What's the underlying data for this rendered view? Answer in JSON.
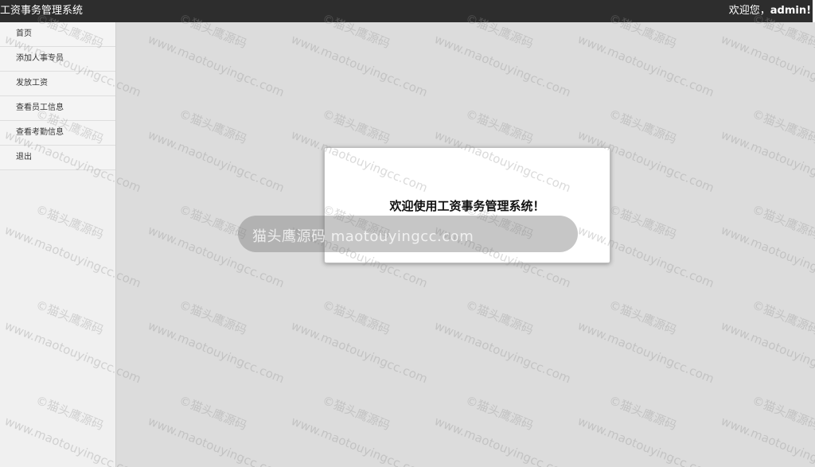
{
  "header": {
    "app_title": "工资事务管理系统",
    "greeting": "欢迎您，",
    "username": "admin!"
  },
  "sidebar": {
    "items": [
      {
        "label": "首页"
      },
      {
        "label": "添加人事专员"
      },
      {
        "label": "发放工资"
      },
      {
        "label": "查看员工信息"
      },
      {
        "label": "查看考勤信息"
      },
      {
        "label": "退出"
      }
    ]
  },
  "dialog": {
    "message": "欢迎使用工资事务管理系统！"
  },
  "watermark": {
    "text_site": "www.maotouyingcc.com",
    "text_brand": "©猫头鹰源码",
    "banner": "猫头鹰源码 maotouyingcc.com"
  }
}
